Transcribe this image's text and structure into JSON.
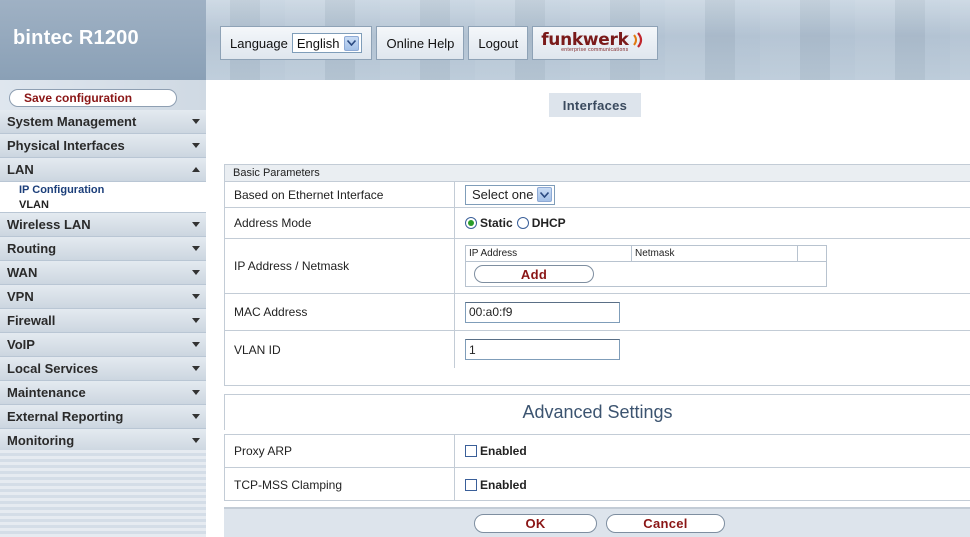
{
  "brand": {
    "title": "bintec R1200"
  },
  "toolbar": {
    "language_label": "Language",
    "language_value": "English",
    "help_label": "Online Help",
    "logout_label": "Logout",
    "logo_text": "funkwerk",
    "logo_sub": "enterprise communications"
  },
  "sidebar": {
    "save_label": "Save configuration",
    "items": [
      {
        "label": "System Management"
      },
      {
        "label": "Physical Interfaces"
      },
      {
        "label": "LAN"
      },
      {
        "label": "Wireless LAN"
      },
      {
        "label": "Routing"
      },
      {
        "label": "WAN"
      },
      {
        "label": "VPN"
      },
      {
        "label": "Firewall"
      },
      {
        "label": "VoIP"
      },
      {
        "label": "Local Services"
      },
      {
        "label": "Maintenance"
      },
      {
        "label": "External Reporting"
      },
      {
        "label": "Monitoring"
      }
    ],
    "lan_sub": [
      {
        "label": "IP Configuration"
      },
      {
        "label": "VLAN"
      }
    ]
  },
  "page": {
    "title": "Interfaces"
  },
  "basic": {
    "header": "Basic Parameters",
    "eth_label": "Based on Ethernet Interface",
    "eth_value": "Select one",
    "addr_mode_label": "Address Mode",
    "addr_mode_static": "Static",
    "addr_mode_dhcp": "DHCP",
    "addr_mode_selected": "Static",
    "ip_label": "IP Address / Netmask",
    "ip_col_ip": "IP Address",
    "ip_col_mask": "Netmask",
    "add_label": "Add",
    "mac_label": "MAC Address",
    "mac_value": "00:a0:f9",
    "vlan_label": "VLAN ID",
    "vlan_value": "1"
  },
  "advanced": {
    "title": "Advanced Settings",
    "proxy_label": "Proxy ARP",
    "proxy_value": "Enabled",
    "proxy_checked": false,
    "tcp_label": "TCP-MSS Clamping",
    "tcp_value": "Enabled",
    "tcp_checked": false
  },
  "footer": {
    "ok_label": "OK",
    "cancel_label": "Cancel"
  },
  "colors": {
    "accent_red": "#8a1515",
    "sidebar_bg": "#dfe6ee",
    "title_bg": "#dde4ec",
    "radio_on": "#2a9d2a"
  }
}
